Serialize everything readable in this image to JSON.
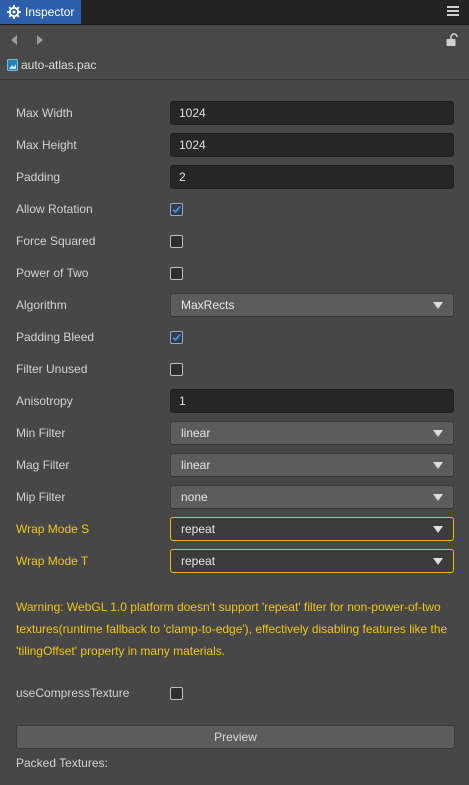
{
  "tab": {
    "title": "Inspector",
    "icon": "gear-icon"
  },
  "file": {
    "name": "auto-atlas.pac",
    "icon": "image-file-icon"
  },
  "properties": {
    "max_width": {
      "label": "Max Width",
      "value": "1024"
    },
    "max_height": {
      "label": "Max Height",
      "value": "1024"
    },
    "padding": {
      "label": "Padding",
      "value": "2"
    },
    "allow_rotation": {
      "label": "Allow Rotation",
      "checked": true
    },
    "force_squared": {
      "label": "Force Squared",
      "checked": false
    },
    "power_of_two": {
      "label": "Power of Two",
      "checked": false
    },
    "algorithm": {
      "label": "Algorithm",
      "value": "MaxRects"
    },
    "padding_bleed": {
      "label": "Padding Bleed",
      "checked": true
    },
    "filter_unused": {
      "label": "Filter Unused",
      "checked": false
    },
    "anisotropy": {
      "label": "Anisotropy",
      "value": "1"
    },
    "min_filter": {
      "label": "Min Filter",
      "value": "linear"
    },
    "mag_filter": {
      "label": "Mag Filter",
      "value": "linear"
    },
    "mip_filter": {
      "label": "Mip Filter",
      "value": "none"
    },
    "wrap_mode_s": {
      "label": "Wrap Mode S",
      "value": "repeat"
    },
    "wrap_mode_t": {
      "label": "Wrap Mode T",
      "value": "repeat"
    },
    "use_compress_texture": {
      "label": "useCompressTexture",
      "checked": false
    }
  },
  "warning": "Warning: WebGL 1.0 platform doesn't support 'repeat' filter for non-power-of-two textures(runtime fallback to 'clamp-to-edge'), effectively disabling features like the 'tilingOffset' property in many materials.",
  "preview_button": "Preview",
  "packed_textures_label": "Packed Textures:",
  "colors": {
    "tab_active": "#2d5fab",
    "panel_bg": "#474747",
    "warning": "#f0c419",
    "checkbox_check": "#4a90e2"
  }
}
